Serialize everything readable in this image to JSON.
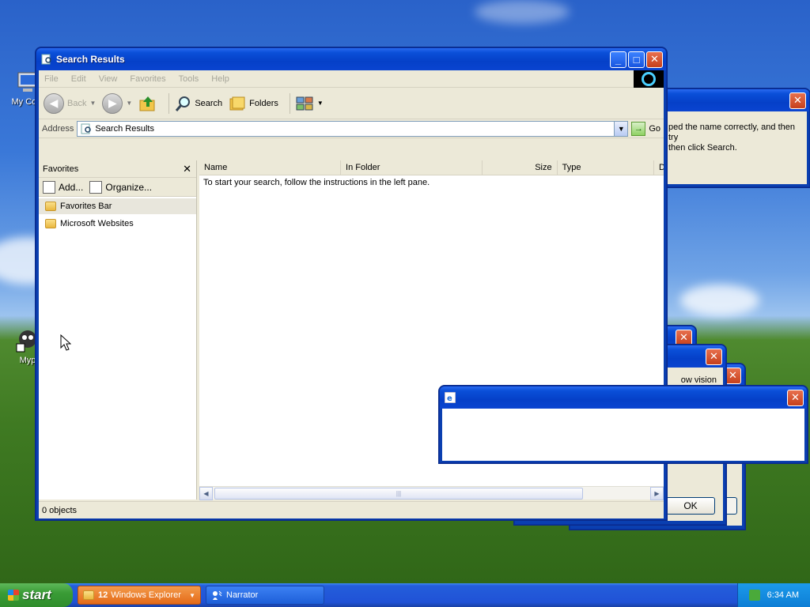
{
  "desktop": {
    "icon1_label": "My Com",
    "icon2_label": "Myp"
  },
  "explorer": {
    "title": "Search Results",
    "menu": [
      "File",
      "Edit",
      "View",
      "Favorites",
      "Tools",
      "Help"
    ],
    "toolbar": {
      "back": "Back",
      "search": "Search",
      "folders": "Folders"
    },
    "address": {
      "label": "Address",
      "value": "Search Results",
      "go": "Go"
    },
    "favorites": {
      "title": "Favorites",
      "add": "Add...",
      "organize": "Organize...",
      "items": [
        "Favorites Bar",
        "Microsoft Websites"
      ]
    },
    "columns": [
      "Name",
      "In Folder",
      "Size",
      "Type",
      "D"
    ],
    "message": "To start your search, follow the instructions in the left pane.",
    "status": "0 objects"
  },
  "bg_dialog": {
    "text_line1": "ped the name correctly, and then try",
    "text_line2": "then click Search."
  },
  "stacked_dialog": {
    "fragment": "ow vision",
    "ok": "OK"
  },
  "taskbar": {
    "start": "start",
    "task1_count": "12",
    "task1_label": "Windows Explorer",
    "task2_label": "Narrator",
    "clock": "6:34 AM"
  },
  "colors": {
    "titlebar": "#0a4fd8",
    "taskbar": "#245edb",
    "start": "#3a9c36",
    "active_task": "#e46a18"
  }
}
